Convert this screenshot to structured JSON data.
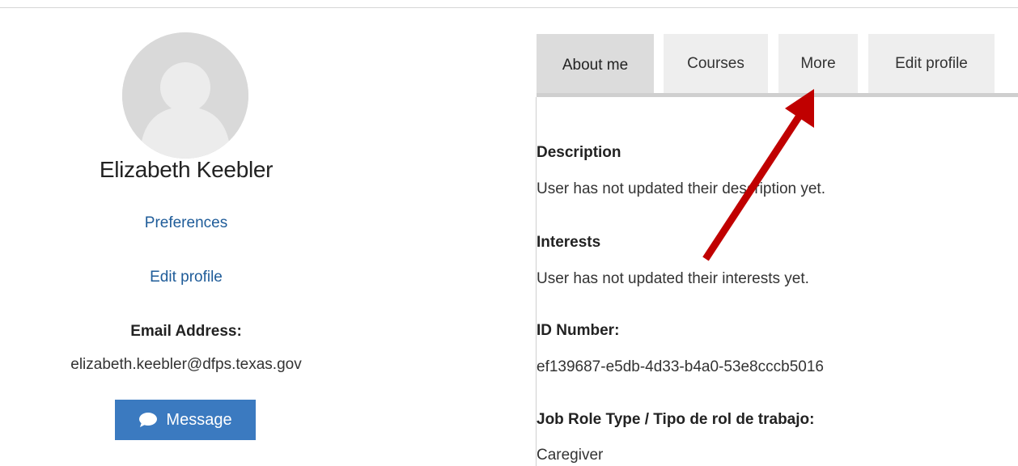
{
  "profile": {
    "name": "Elizabeth Keebler",
    "preferences_link": "Preferences",
    "edit_profile_link": "Edit profile",
    "email_label": "Email Address:",
    "email_value": "elizabeth.keebler@dfps.texas.gov",
    "message_button": "Message"
  },
  "tabs": [
    {
      "label": "About me",
      "active": true
    },
    {
      "label": "Courses",
      "active": false
    },
    {
      "label": "More",
      "active": false
    },
    {
      "label": "Edit profile",
      "active": false
    }
  ],
  "sections": [
    {
      "title": "Description",
      "value": "User has not updated their description yet."
    },
    {
      "title": "Interests",
      "value": "User has not updated their interests yet."
    },
    {
      "title": "ID Number:",
      "value": "ef139687-e5db-4d33-b4a0-53e8cccb5016"
    },
    {
      "title": "Job Role Type / Tipo de rol de trabajo:",
      "value": "Caregiver"
    }
  ],
  "icons": {
    "avatar": "user-silhouette-icon",
    "message": "speech-bubble-icon",
    "annotation": "red-arrow-annotation"
  },
  "colors": {
    "link": "#1f5c99",
    "button": "#3b7ac0",
    "active_tab": "#dcdcdc",
    "inactive_tab": "#eeeeee",
    "annotation_arrow": "#c00000"
  }
}
